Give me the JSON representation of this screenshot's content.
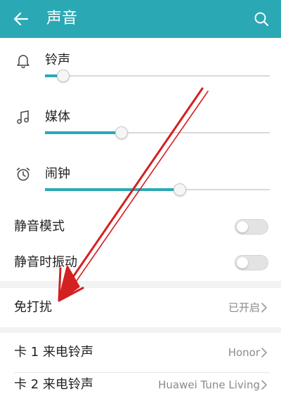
{
  "header": {
    "title": "声音",
    "back_icon": "arrow-left-icon",
    "search_icon": "search-icon",
    "background": "#2aa9b5"
  },
  "volume": [
    {
      "label": "铃声",
      "icon": "bell-icon",
      "level": 0.08
    },
    {
      "label": "媒体",
      "icon": "music-note-icon",
      "level": 0.34
    },
    {
      "label": "闹钟",
      "icon": "alarm-clock-icon",
      "level": 0.6
    }
  ],
  "switches": [
    {
      "label": "静音模式",
      "on": false
    },
    {
      "label": "静音时振动",
      "on": false
    }
  ],
  "dnd": {
    "label": "免打扰",
    "value": "已开启"
  },
  "ringtones": [
    {
      "label": "卡 1 来电铃声",
      "value": "Honor"
    },
    {
      "label": "卡 2 来电铃声",
      "value": "Huawei Tune Living"
    }
  ],
  "colors": {
    "accent": "#2aa9b5",
    "annotation_arrow": "#d32020"
  }
}
